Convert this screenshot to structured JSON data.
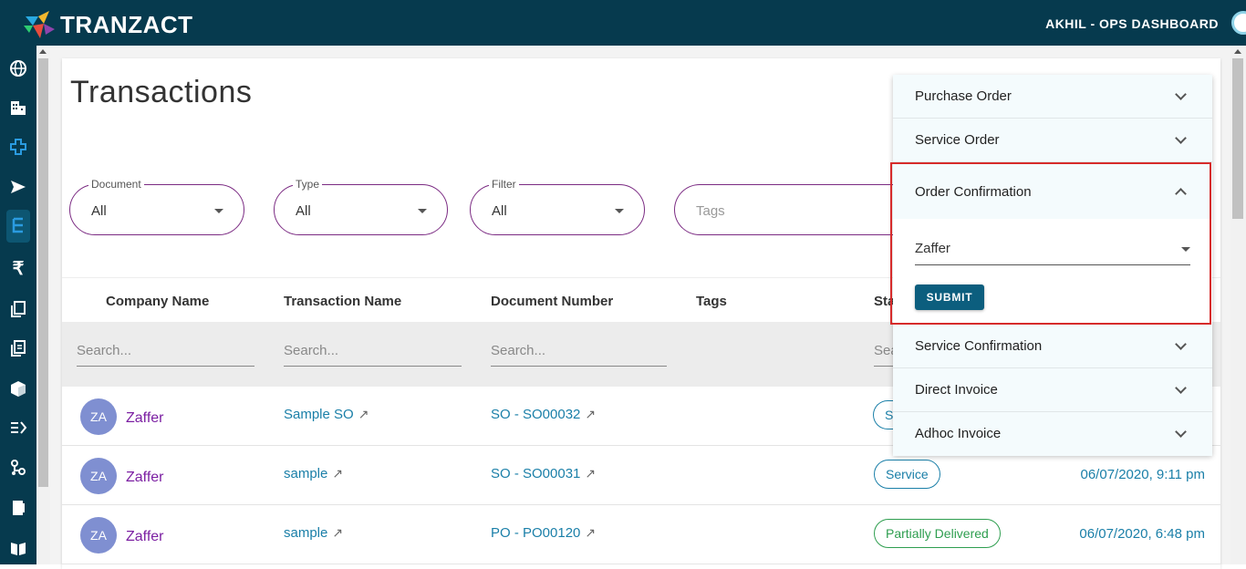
{
  "header": {
    "brand": "TRANZACT",
    "user_label": "AKHIL - OPS DASHBOARD"
  },
  "sidebar": {
    "icons": [
      "globe-icon",
      "building-icon",
      "plus-cross-icon",
      "send-icon",
      "list-tree-icon",
      "rupee-icon",
      "copy-icon",
      "document-copy-icon",
      "package-icon",
      "list-flow-icon",
      "network-icon",
      "book-icon",
      "book-open-icon"
    ]
  },
  "page": {
    "title": "Transactions"
  },
  "filters": {
    "document": {
      "legend": "Document",
      "value": "All"
    },
    "type": {
      "legend": "Type",
      "value": "All"
    },
    "filter": {
      "legend": "Filter",
      "value": "All"
    },
    "tags": {
      "placeholder": "Tags"
    }
  },
  "table": {
    "headers": [
      "Company Name",
      "Transaction Name",
      "Document Number",
      "Tags",
      "Sta"
    ],
    "search_placeholder": "Search...",
    "search_partial": "Sea",
    "rows": [
      {
        "initials": "ZA",
        "company": "Zaffer",
        "transaction": "Sample SO",
        "doc": "SO - SO00032",
        "status": "S",
        "date": ""
      },
      {
        "initials": "ZA",
        "company": "Zaffer",
        "transaction": "sample",
        "doc": "SO - SO00031",
        "status": "Service",
        "date": "06/07/2020, 9:11 pm"
      },
      {
        "initials": "ZA",
        "company": "Zaffer",
        "transaction": "sample",
        "doc": "PO - PO00120",
        "status": "Partially Delivered",
        "date": "06/07/2020, 6:48 pm"
      }
    ]
  },
  "panel": {
    "items": [
      "Purchase Order",
      "Service Order",
      "Order Confirmation",
      "Service Confirmation",
      "Direct Invoice",
      "Adhoc Invoice"
    ],
    "open_select_value": "Zaffer",
    "submit_label": "SUBMIT"
  },
  "colors": {
    "topbar": "#063a4e",
    "accent": "#7b2b83",
    "link": "#1a7fa8",
    "highlight": "#d62b2b"
  }
}
